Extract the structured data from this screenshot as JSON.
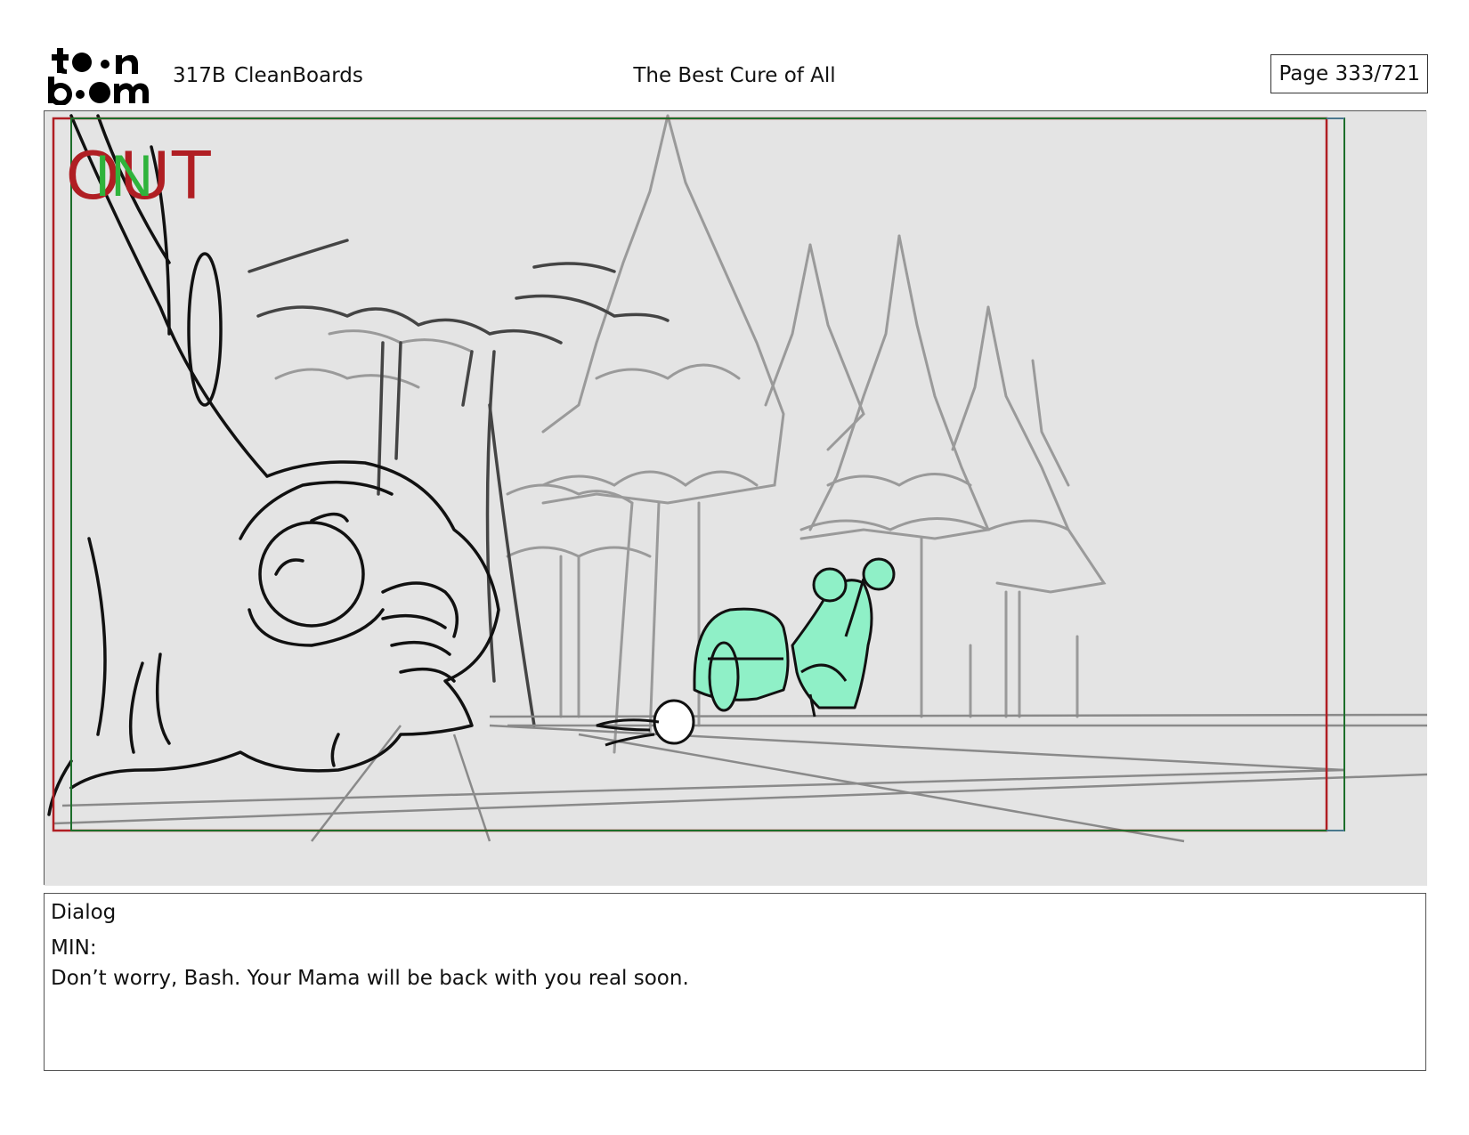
{
  "header": {
    "scene_id": "317B",
    "scene_name": "CleanBoards",
    "title": "The Best Cure of All",
    "page": "Page 333/721"
  },
  "logo": {
    "text_top": "toon",
    "text_bottom": "boom"
  },
  "panel": {
    "out_label": "OUT",
    "in_label": "IN",
    "colors": {
      "out_frame": "#b01e23",
      "in_frame": "#1c6e2a",
      "highlight": "#8ff0c7",
      "background": "#e4e4e4"
    }
  },
  "dialog": {
    "label": "Dialog",
    "speaker": "MIN:",
    "line": "Don’t worry, Bash. Your Mama will be back with you real soon."
  }
}
